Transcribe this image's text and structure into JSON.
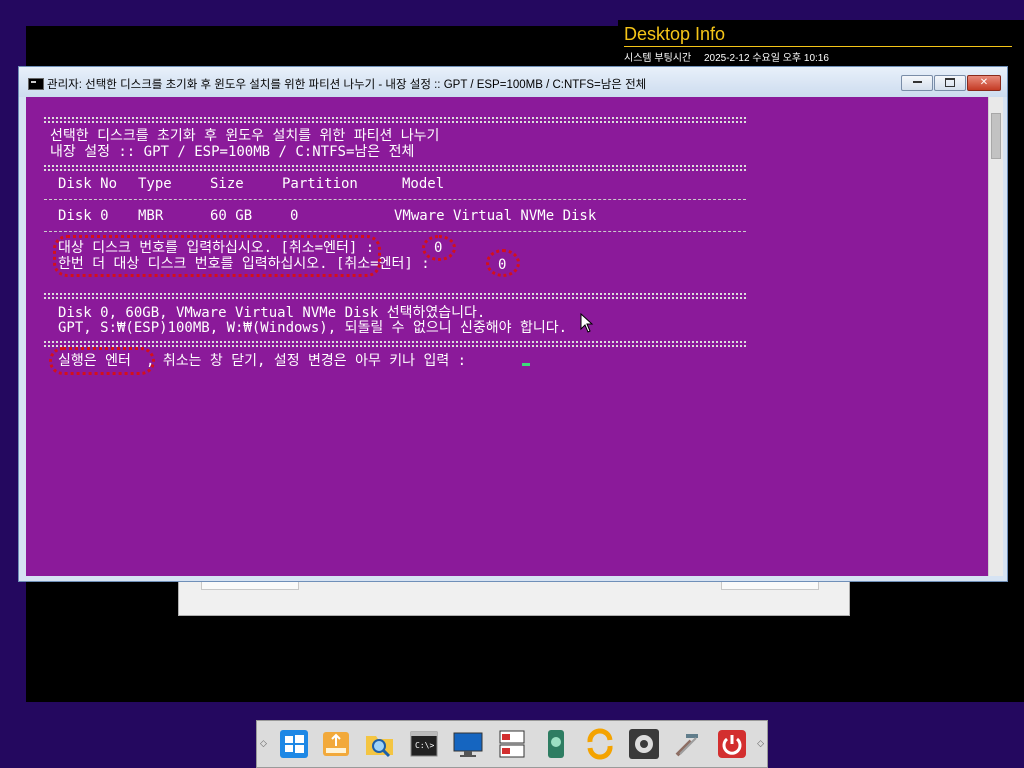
{
  "desktop_info": {
    "title": "Desktop Info",
    "label": "시스템 부팅시간",
    "value": "2025-2-12 수요일 오후 10:16"
  },
  "window": {
    "title": "관리자:  선택한 디스크를 초기화 후 윈도우 설치를 위한 파티션 나누기 - 내장 설정 :: GPT / ESP=100MB / C:NTFS=남은 전체"
  },
  "console": {
    "header_line1": "선택한 디스크를 초기화 후 윈도우 설치를 위한 파티션 나누기",
    "header_line2": "내장 설정 :: GPT / ESP=100MB / C:NTFS=남은 전체",
    "columns": [
      "Disk No",
      "Type",
      "Size",
      "Partition",
      "Model"
    ],
    "rows": [
      {
        "disk_no": "Disk 0",
        "type": "MBR",
        "size": "60 GB",
        "partition": "0",
        "model": "VMware Virtual NVMe Disk"
      }
    ],
    "prompt1": "대상 디스크 번호를 입력하십시오. [취소=엔터] :",
    "answer1": "0",
    "prompt2": "한번 더 대상 디스크 번호를 입력하십시오. [취소=엔터] :",
    "answer2": "0",
    "summary1": "Disk 0, 60GB, VMware Virtual NVMe Disk 선택하였습니다.",
    "summary2": "GPT, S:₩(ESP)100MB, W:₩(Windows), 되돌릴 수 없으니 신중해야 합니다.",
    "final_prompt_highlight": "실행은 엔터",
    "final_prompt_rest": ", 취소는 창 닫기, 설정 변경은 아무 키나 입력 :"
  },
  "taskbar": {
    "icons": [
      "windows-start-icon",
      "usb-drive-icon",
      "folder-search-icon",
      "command-prompt-icon",
      "monitor-icon",
      "partition-tool-icon",
      "disk-health-icon",
      "sync-icon",
      "settings-gear-icon",
      "tools-icon",
      "power-icon"
    ]
  },
  "colors": {
    "console_bg": "#8b1a9a",
    "desktop_bg": "#24085f",
    "highlight_ring": "#d4101a",
    "info_accent": "#f5c518"
  }
}
